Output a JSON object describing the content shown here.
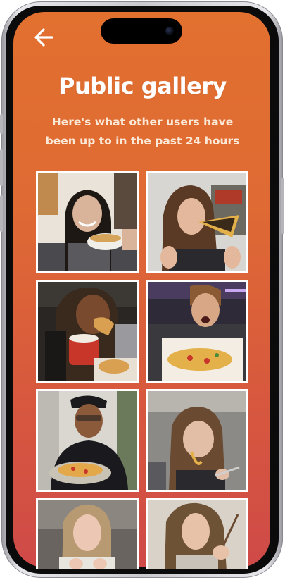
{
  "header": {
    "back_icon": "arrow-left-icon",
    "title": "Public gallery",
    "subtitle": "Here's what other users have been up to in the past 24 hours"
  },
  "gallery": {
    "tiles": [
      {
        "subject": "woman smiling holding a bowl of food"
      },
      {
        "subject": "woman with curly hair eating a slice of pizza"
      },
      {
        "subject": "woman with braids eating in a car with a red cup"
      },
      {
        "subject": "young man with open mouth above a pizza box"
      },
      {
        "subject": "man in cap holding a pizza on a plate"
      },
      {
        "subject": "woman in car eating noodles with a fork"
      },
      {
        "subject": "woman with wet hair"
      },
      {
        "subject": "woman with long hair holding a fork"
      }
    ]
  },
  "colors": {
    "background_top": "#e2702f",
    "background_bottom": "#cf4a48",
    "tile_border": "#ffffff",
    "title_text": "#ffffff"
  }
}
